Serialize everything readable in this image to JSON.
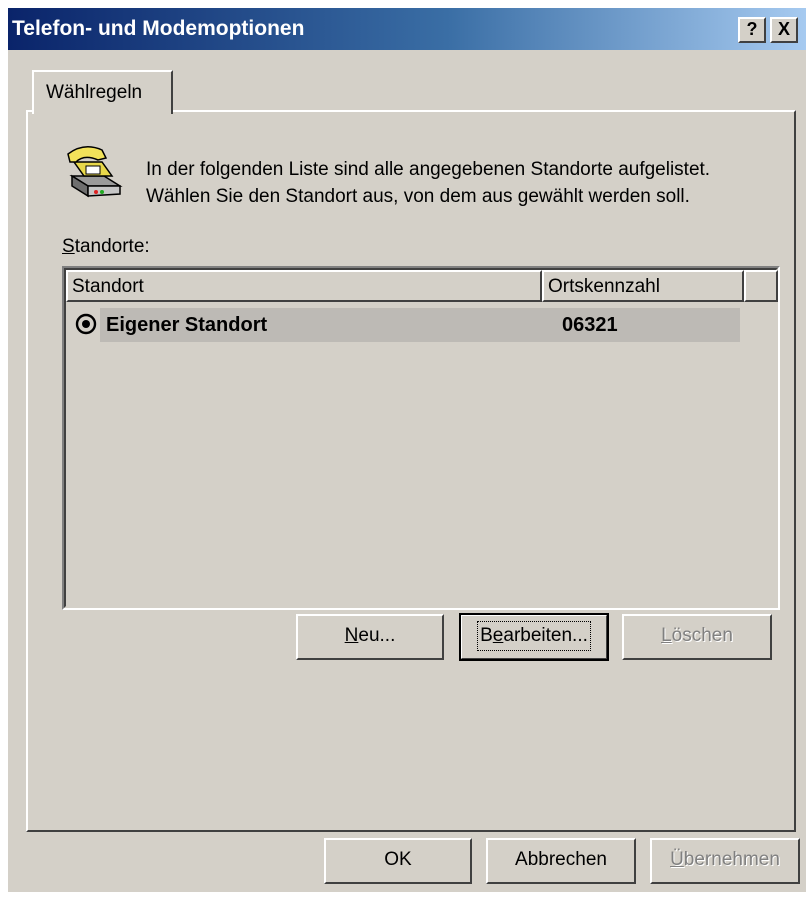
{
  "window": {
    "title": "Telefon- und Modemoptionen",
    "help_button": "?",
    "close_button": "X"
  },
  "tabs": [
    {
      "label": "Wählregeln",
      "selected": true
    }
  ],
  "description": {
    "line1": "In der folgenden Liste sind alle angegebenen Standorte aufgelistet.",
    "line2": "Wählen Sie den Standort aus, von dem aus gewählt werden soll."
  },
  "locations_label": {
    "mnemonic": "S",
    "rest": "tandorte:"
  },
  "list": {
    "columns": [
      "Standort",
      "Ortskennzahl"
    ],
    "rows": [
      {
        "standort": "Eigener Standort",
        "ortskennzahl": "06321",
        "selected": true
      }
    ]
  },
  "buttons": {
    "neu": {
      "mnemonic": "N",
      "rest": "eu..."
    },
    "bearbeiten": {
      "pre": "B",
      "mnemonic": "e",
      "rest": "arbeiten..."
    },
    "loeschen": {
      "mnemonic": "L",
      "rest": "öschen"
    },
    "ok": "OK",
    "abbrechen": "Abbrechen",
    "uebernehmen": {
      "mnemonic": "Ü",
      "rest": "bernehmen"
    }
  },
  "icons": {
    "phone": "telephone-icon",
    "row": "location-radio-icon"
  },
  "colors": {
    "title_start": "#0a246a",
    "title_end": "#a6caf0",
    "face": "#d4d0c8"
  }
}
